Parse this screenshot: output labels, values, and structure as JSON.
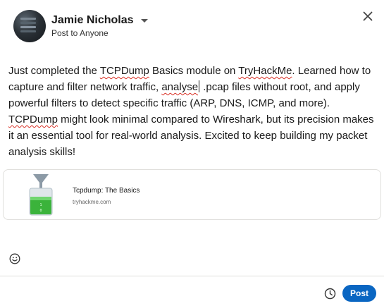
{
  "header": {
    "author_name": "Jamie Nicholas",
    "audience": "Post to Anyone"
  },
  "post": {
    "seg1": "Just completed the ",
    "word_tcpdump_basics": "TCPDump",
    "seg2": " Basics module on ",
    "word_tryhackme": "TryHackMe",
    "seg3": ". Learned how to capture and filter network traffic, ",
    "word_analyse": "analyse",
    "seg4": " .pcap files without root, and apply powerful filters to detect specific traffic (ARP, DNS, ICMP, and more). ",
    "word_tcpdump2": "TCPDump",
    "seg5": " might look minimal compared to Wireshark, but its precision makes it an essential tool for real-world analysis. Excited to keep building my packet analysis skills!"
  },
  "link_preview": {
    "title": "Tcpdump: The Basics",
    "domain": "tryhackme.com"
  },
  "footer": {
    "post_label": "Post"
  },
  "icons": [
    "avatar",
    "chevron-down-icon",
    "close-icon",
    "emoji-icon",
    "clock-icon",
    "funnel-beaker-thumbnail"
  ],
  "colors": {
    "primary": "#0a66c2",
    "text": "#191919",
    "spellcheck": "#d93025",
    "beaker_green": "#3bb33b"
  }
}
